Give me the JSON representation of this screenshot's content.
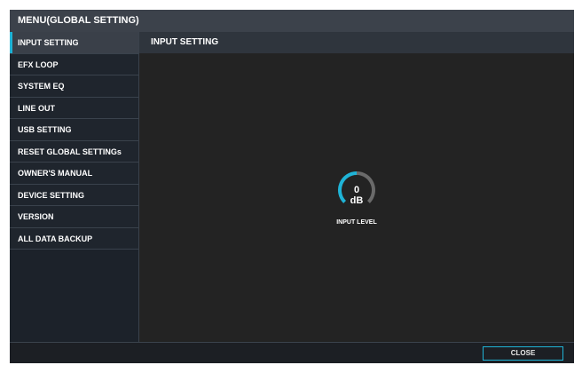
{
  "window": {
    "title": "MENU(GLOBAL SETTING)"
  },
  "sidebar": {
    "items": [
      {
        "label": "INPUT SETTING",
        "selected": true
      },
      {
        "label": "EFX LOOP"
      },
      {
        "label": "SYSTEM EQ"
      },
      {
        "label": "LINE OUT"
      },
      {
        "label": "USB SETTING"
      },
      {
        "label": "RESET GLOBAL SETTINGs"
      },
      {
        "label": "OWNER'S MANUAL"
      },
      {
        "label": "DEVICE SETTING"
      },
      {
        "label": "VERSION"
      },
      {
        "label": "ALL DATA BACKUP"
      }
    ]
  },
  "content": {
    "title": "INPUT SETTING",
    "knob": {
      "value": "0",
      "unit": "dB",
      "label": "INPUT LEVEL",
      "level_fraction": 0.5
    }
  },
  "footer": {
    "close_label": "CLOSE"
  },
  "colors": {
    "accent": "#1fb3d6",
    "knob_track": "#6a6a6a"
  }
}
